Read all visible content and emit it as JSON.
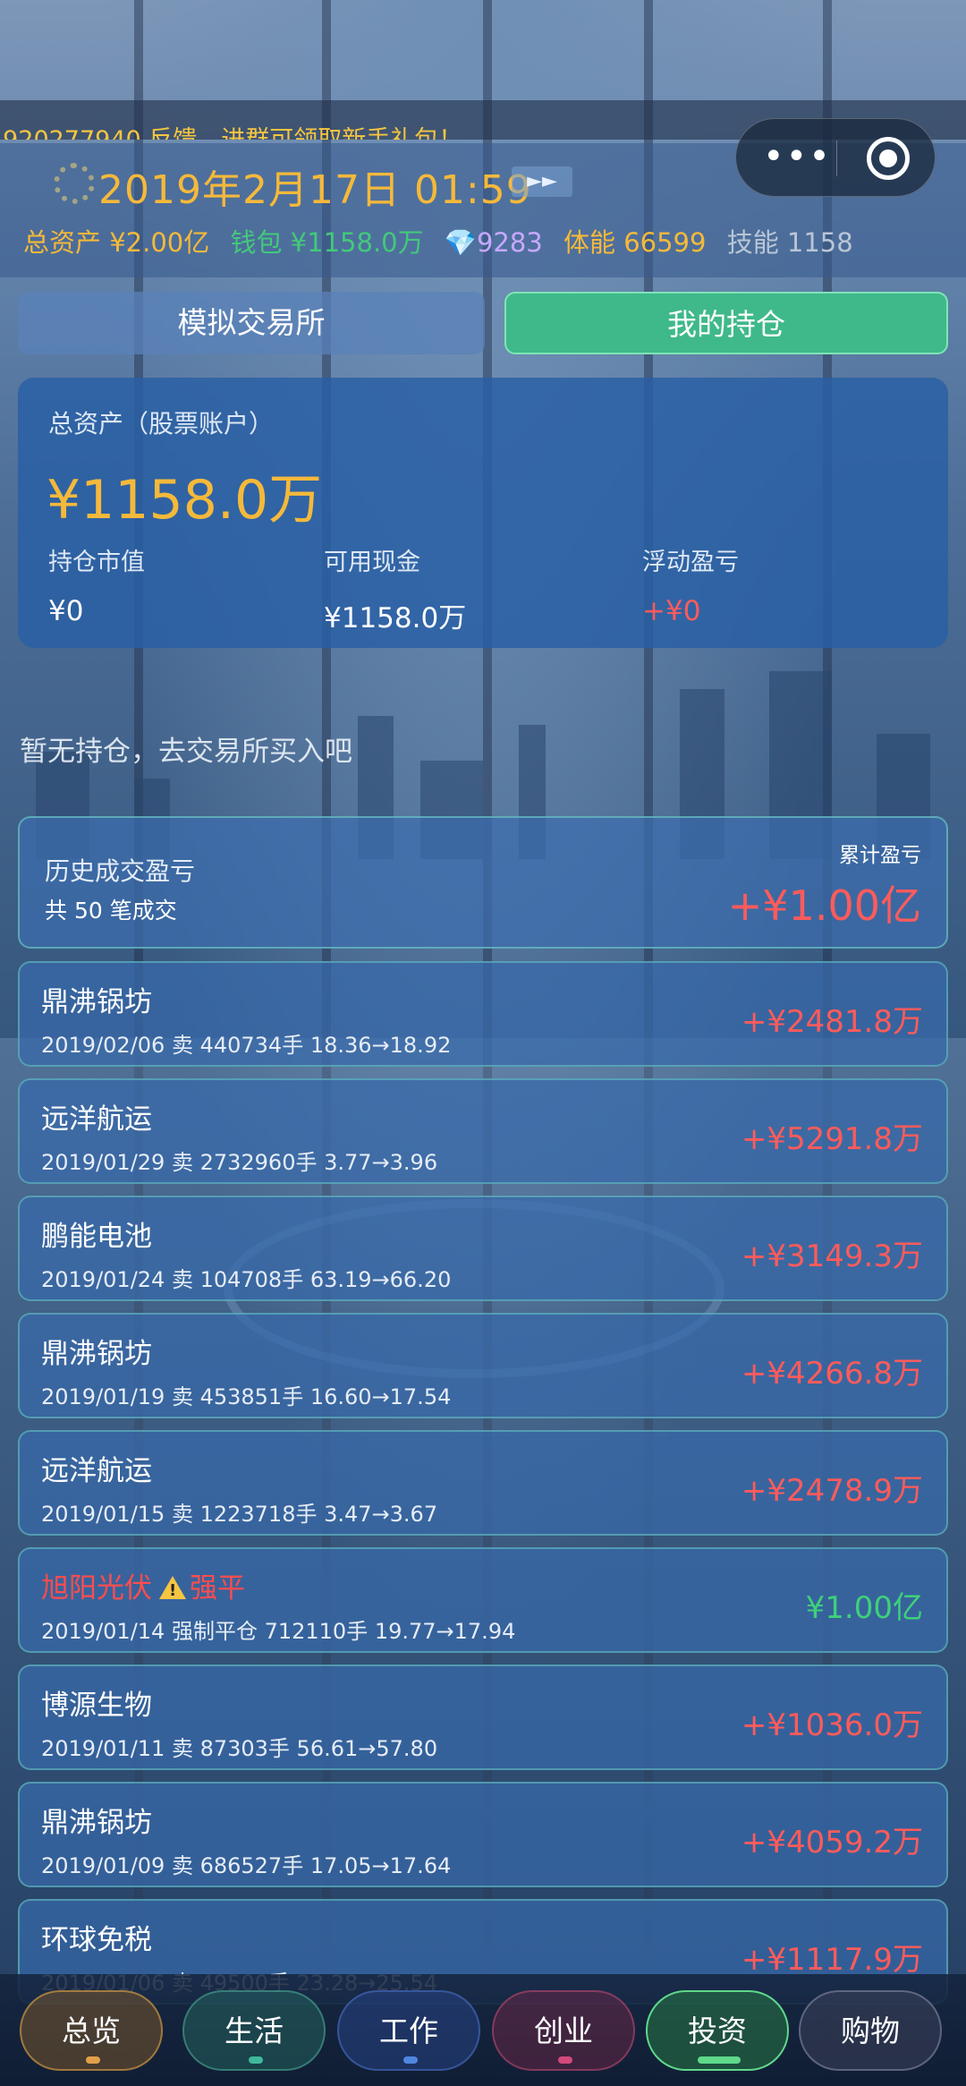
{
  "marquee": {
    "text": ":920277940 反馈，进群可领取新手礼包！"
  },
  "header": {
    "datetime": "2019年2月17日 01:59",
    "speed_label": "►►",
    "stats": {
      "total_assets": "总资产 ¥2.00亿",
      "wallet": "钱包 ¥1158.0万",
      "gems": "💎9283",
      "stamina": "体能 66599",
      "skill": "技能 1158"
    }
  },
  "capsule": {
    "more_label": "•••"
  },
  "tabs": {
    "exchange": "模拟交易所",
    "holdings": "我的持仓"
  },
  "asset_card": {
    "label": "总资产（股票账户）",
    "total": "¥1158.0万",
    "market_value_label": "持仓市值",
    "market_value": "¥0",
    "cash_label": "可用现金",
    "cash": "¥1158.0万",
    "floating_label": "浮动盈亏",
    "floating": "+¥0"
  },
  "empty_text": "暂无持仓，去交易所买入吧",
  "history": {
    "title": "历史成交盈亏",
    "count": "共 50 笔成交",
    "cumulative_label": "累计盈亏",
    "cumulative_value": "+¥1.00亿"
  },
  "trades": [
    {
      "name": "鼎沸锅坊",
      "detail": "2019/02/06  卖 440734手  18.36→18.92",
      "pnl": "+¥2481.8万"
    },
    {
      "name": "远洋航运",
      "detail": "2019/01/29  卖 2732960手  3.77→3.96",
      "pnl": "+¥5291.8万"
    },
    {
      "name": "鹏能电池",
      "detail": "2019/01/24  卖 104708手  63.19→66.20",
      "pnl": "+¥3149.3万"
    },
    {
      "name": "鼎沸锅坊",
      "detail": "2019/01/19  卖 453851手  16.60→17.54",
      "pnl": "+¥4266.8万"
    },
    {
      "name": "远洋航运",
      "detail": "2019/01/15  卖 1223718手  3.47→3.67",
      "pnl": "+¥2478.9万"
    },
    {
      "name": "旭阳光伏",
      "tag": "强平",
      "detail": "2019/01/14  强制平仓 712110手  19.77→17.94",
      "pnl": "¥1.00亿"
    },
    {
      "name": "博源生物",
      "detail": "2019/01/11  卖 87303手  56.61→57.80",
      "pnl": "+¥1036.0万"
    },
    {
      "name": "鼎沸锅坊",
      "detail": "2019/01/09  卖 686527手  17.05→17.64",
      "pnl": "+¥4059.2万"
    },
    {
      "name": "环球免税",
      "detail": "2019/01/06  卖 49500手  23.28→25.54",
      "pnl": "+¥1117.9万"
    }
  ],
  "nav": {
    "overview": "总览",
    "life": "生活",
    "work": "工作",
    "business": "创业",
    "invest": "投资",
    "shopping": "购物"
  }
}
